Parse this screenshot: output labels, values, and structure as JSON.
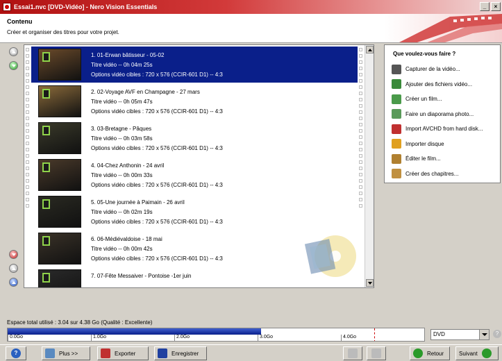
{
  "window": {
    "title": "Essai1.nvc [DVD-Vidéo] - Nero Vision Essentials"
  },
  "header": {
    "title": "Contenu",
    "subtitle": "Créer et organiser des titres pour votre projet."
  },
  "titles": [
    {
      "name": "1. 01-Erwan bâtisseur - 05-02",
      "duration": "Titre vidéo -- 0h 04m 25s",
      "options": "Options vidéo cibles : 720 x 576 (CCIR-601 D1) -- 4:3",
      "selected": true,
      "thumb_color": "#6a4a2a"
    },
    {
      "name": "2. 02-Voyage AVF en Champagne -  27 mars",
      "duration": "Titre vidéo -- 0h 05m 47s",
      "options": "Options vidéo cibles : 720 x 576 (CCIR-601 D1) -- 4:3",
      "selected": false,
      "thumb_color": "#8a6a3a"
    },
    {
      "name": "3. 03-Bretagne - Pâques",
      "duration": "Titre vidéo -- 0h 03m 58s",
      "options": "Options vidéo cibles : 720 x 576 (CCIR-601 D1) -- 4:3",
      "selected": false,
      "thumb_color": "#3a3a2a"
    },
    {
      "name": "4. 04-Chez Anthonin - 24 avril",
      "duration": "Titre vidéo -- 0h 00m 33s",
      "options": "Options vidéo cibles : 720 x 576 (CCIR-601 D1) -- 4:3",
      "selected": false,
      "thumb_color": "#4a3a2a"
    },
    {
      "name": "5. 05-Une journée à Paimain - 26 avril",
      "duration": "Titre vidéo -- 0h 02m 19s",
      "options": "Options vidéo cibles : 720 x 576 (CCIR-601 D1) -- 4:3",
      "selected": false,
      "thumb_color": "#2a2a22"
    },
    {
      "name": "6. 06-Médiévaldoise - 18 mai",
      "duration": "Titre vidéo -- 0h 00m 42s",
      "options": "Options vidéo cibles : 720 x 576 (CCIR-601 D1) -- 4:3",
      "selected": false,
      "thumb_color": "#3a3228"
    },
    {
      "name": "7. 07-Fête Messaiver - Pontoise -1er juin",
      "duration": "",
      "options": "",
      "selected": false,
      "thumb_color": "#2a2a2a"
    }
  ],
  "panel": {
    "title": "Que voulez-vous faire ?",
    "actions": [
      {
        "label": "Capturer de la vidéo...",
        "icon": "camera-icon",
        "color": "#555555"
      },
      {
        "label": "Ajouter des fichiers vidéo...",
        "icon": "add-video-icon",
        "color": "#3a8a3a"
      },
      {
        "label": "Créer un film...",
        "icon": "create-movie-icon",
        "color": "#4a9a4a"
      },
      {
        "label": "Faire un diaporama photo...",
        "icon": "slideshow-icon",
        "color": "#5a9a5a"
      },
      {
        "label": "Import AVCHD from hard disk...",
        "icon": "import-avchd-icon",
        "color": "#c03030"
      },
      {
        "label": "Importer disque",
        "icon": "import-disc-icon",
        "color": "#e0a020"
      },
      {
        "label": "Éditer le film...",
        "icon": "edit-movie-icon",
        "color": "#b08030"
      },
      {
        "label": "Créer des chapitres...",
        "icon": "chapters-icon",
        "color": "#c09040"
      }
    ]
  },
  "disk": {
    "label": "Espace total utilisé : 3.04 sur 4.38 Go (Qualité : Excellente)",
    "used_gb": 3.04,
    "capacity_gb": 4.38,
    "ticks": [
      "0.0Go",
      "1.0Go",
      "2.0Go",
      "3.0Go",
      "4.0Go"
    ],
    "media": "DVD"
  },
  "toolbar": {
    "help_label": "?",
    "more_label": "Plus >>",
    "export_label": "Exporter",
    "save_label": "Enregistrer",
    "back_label": "Retour",
    "next_label": "Suivant"
  }
}
